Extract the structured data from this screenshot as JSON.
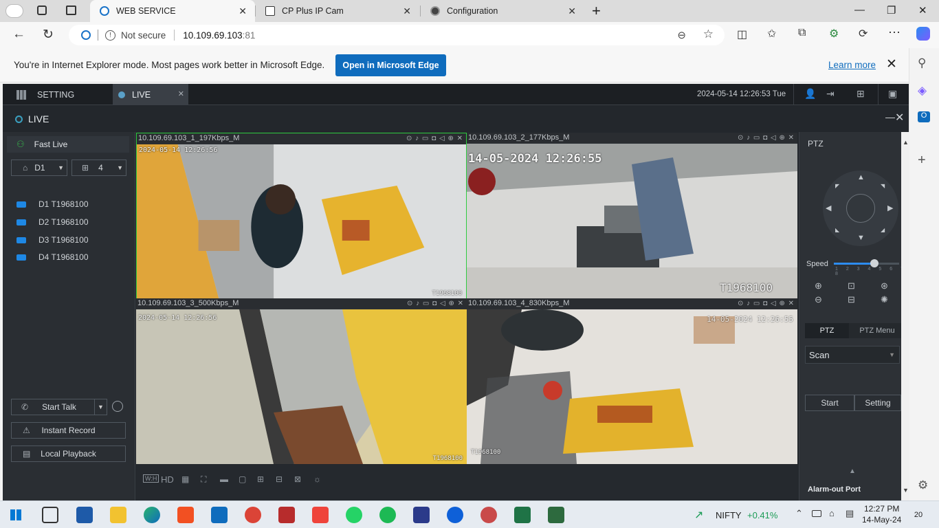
{
  "browser": {
    "tabs": [
      {
        "title": "WEB SERVICE",
        "active": true
      },
      {
        "title": "CP Plus IP Cam",
        "active": false
      },
      {
        "title": "Configuration",
        "active": false
      }
    ],
    "address": {
      "security": "Not secure",
      "url_host": "10.109.69.103",
      "url_port": ":81"
    },
    "ie_banner": {
      "message": "You're in Internet Explorer mode. Most pages work better in Microsoft Edge.",
      "open_button": "Open in Microsoft Edge",
      "learn_more": "Learn more"
    }
  },
  "app": {
    "top_tabs": {
      "setting": "SETTING",
      "live": "LIVE"
    },
    "datetime": "2024-05-14 12:26:53 Tue",
    "live_header": "LIVE",
    "left_panel": {
      "fast_live": "Fast Live",
      "device_select": "D1",
      "split_select": "4",
      "devices": [
        "D1 T1968100",
        "D2 T1968100",
        "D3 T1968100",
        "D4 T1968100"
      ],
      "start_talk": "Start Talk",
      "instant_record": "Instant Record",
      "local_playback": "Local Playback"
    },
    "video_tiles": [
      {
        "title": "10.109.69.103_1_197Kbps_M",
        "osd_time": "2024-05-14 12:26:56",
        "osd_name": "T1968100"
      },
      {
        "title": "10.109.69.103_2_177Kbps_M",
        "osd_time": "14-05-2024 12:26:55",
        "osd_name": "T1968100"
      },
      {
        "title": "10.109.69.103_3_500Kbps_M",
        "osd_time": "2024-05-14 12:26:56",
        "osd_name": "T1968100"
      },
      {
        "title": "10.109.69.103_4_830Kbps_M",
        "osd_time": "14-05-2024 12:26:55",
        "osd_name": "T1968100"
      }
    ],
    "video_bar": {
      "hd_label": "HD"
    },
    "ptz": {
      "title": "PTZ",
      "speed_label": "Speed",
      "speed_scale": "1 2 3 4 5 6 7 8",
      "speed_value": 5,
      "speed_max": 8,
      "tab_ptz": "PTZ",
      "tab_menu": "PTZ Menu",
      "mode": "Scan",
      "start": "Start",
      "setting": "Setting",
      "alarm_out": "Alarm-out Port"
    }
  },
  "taskbar": {
    "ticker_name": "NIFTY",
    "ticker_change": "+0.41%",
    "time": "12:27 PM",
    "date": "14-May-24",
    "notification_count": "20"
  },
  "colors": {
    "accent": "#0f6cbd",
    "app_bg": "#23272c",
    "active_tile_border": "#2ecc40",
    "ticker_positive": "#1a9b55"
  }
}
